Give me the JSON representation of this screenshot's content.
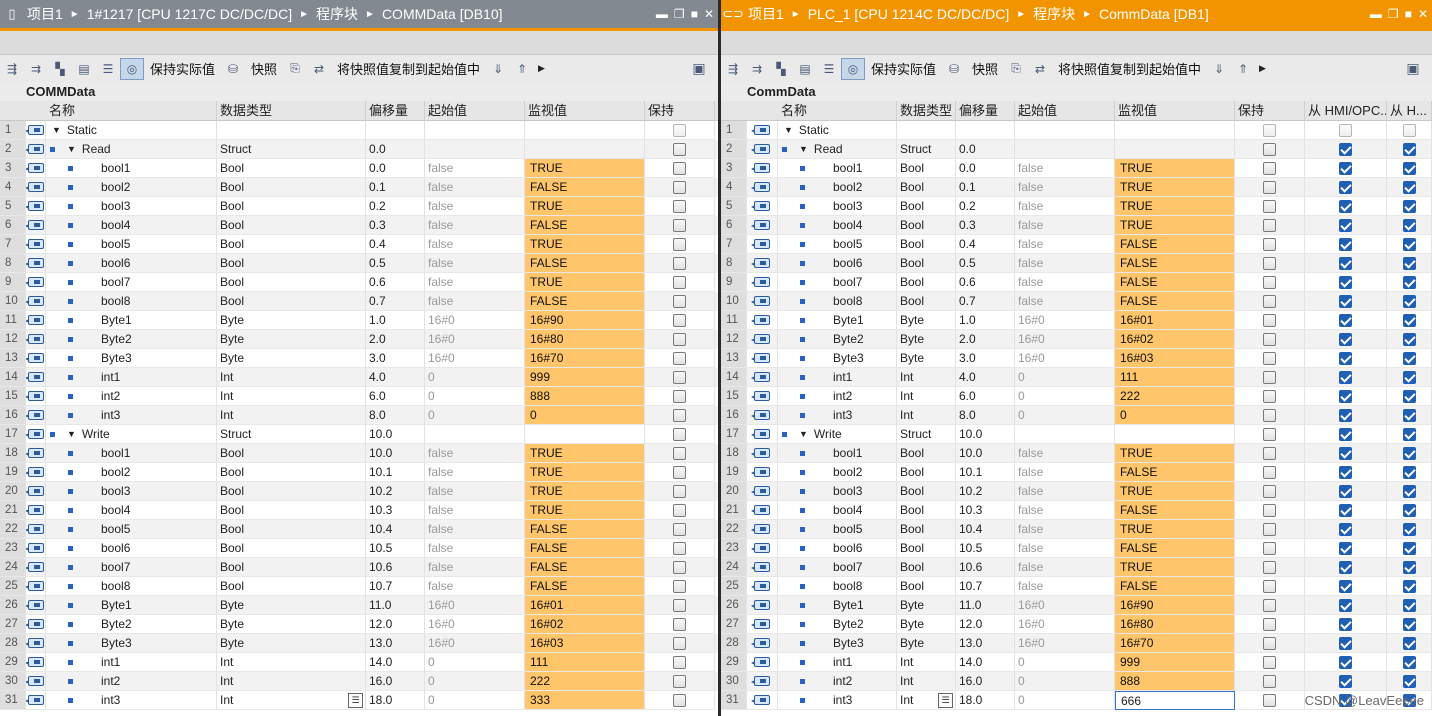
{
  "left": {
    "title": {
      "project": "项目1",
      "device": "1#1217 [CPU 1217C DC/DC/DC]",
      "blocks": "程序块",
      "db": "COMMData [DB10]"
    },
    "toolbar": {
      "keep_actual": "保持实际值",
      "snapshot": "快照",
      "copy_snapshot": "将快照值复制到起始值中"
    },
    "db_name": "COMMData",
    "columns": [
      "名称",
      "数据类型",
      "偏移量",
      "起始值",
      "监视值",
      "保持"
    ],
    "rows": [
      {
        "n": "1",
        "name": "Static",
        "type": "",
        "offset": "",
        "start": "",
        "monitor": "",
        "level": 0,
        "group": "static"
      },
      {
        "n": "2",
        "name": "Read",
        "type": "Struct",
        "offset": "0.0",
        "start": "",
        "monitor": "",
        "level": 1,
        "group": "struct"
      },
      {
        "n": "3",
        "name": "bool1",
        "type": "Bool",
        "offset": "0.0",
        "start": "false",
        "monitor": "TRUE",
        "level": 2
      },
      {
        "n": "4",
        "name": "bool2",
        "type": "Bool",
        "offset": "0.1",
        "start": "false",
        "monitor": "FALSE",
        "level": 2
      },
      {
        "n": "5",
        "name": "bool3",
        "type": "Bool",
        "offset": "0.2",
        "start": "false",
        "monitor": "TRUE",
        "level": 2
      },
      {
        "n": "6",
        "name": "bool4",
        "type": "Bool",
        "offset": "0.3",
        "start": "false",
        "monitor": "FALSE",
        "level": 2
      },
      {
        "n": "7",
        "name": "bool5",
        "type": "Bool",
        "offset": "0.4",
        "start": "false",
        "monitor": "TRUE",
        "level": 2
      },
      {
        "n": "8",
        "name": "bool6",
        "type": "Bool",
        "offset": "0.5",
        "start": "false",
        "monitor": "FALSE",
        "level": 2
      },
      {
        "n": "9",
        "name": "bool7",
        "type": "Bool",
        "offset": "0.6",
        "start": "false",
        "monitor": "TRUE",
        "level": 2
      },
      {
        "n": "10",
        "name": "bool8",
        "type": "Bool",
        "offset": "0.7",
        "start": "false",
        "monitor": "FALSE",
        "level": 2
      },
      {
        "n": "11",
        "name": "Byte1",
        "type": "Byte",
        "offset": "1.0",
        "start": "16#0",
        "monitor": "16#90",
        "level": 2
      },
      {
        "n": "12",
        "name": "Byte2",
        "type": "Byte",
        "offset": "2.0",
        "start": "16#0",
        "monitor": "16#80",
        "level": 2
      },
      {
        "n": "13",
        "name": "Byte3",
        "type": "Byte",
        "offset": "3.0",
        "start": "16#0",
        "monitor": "16#70",
        "level": 2
      },
      {
        "n": "14",
        "name": "int1",
        "type": "Int",
        "offset": "4.0",
        "start": "0",
        "monitor": "999",
        "level": 2
      },
      {
        "n": "15",
        "name": "int2",
        "type": "Int",
        "offset": "6.0",
        "start": "0",
        "monitor": "888",
        "level": 2
      },
      {
        "n": "16",
        "name": "int3",
        "type": "Int",
        "offset": "8.0",
        "start": "0",
        "monitor": "0",
        "level": 2
      },
      {
        "n": "17",
        "name": "Write",
        "type": "Struct",
        "offset": "10.0",
        "start": "",
        "monitor": "",
        "level": 1,
        "group": "struct"
      },
      {
        "n": "18",
        "name": "bool1",
        "type": "Bool",
        "offset": "10.0",
        "start": "false",
        "monitor": "TRUE",
        "level": 2
      },
      {
        "n": "19",
        "name": "bool2",
        "type": "Bool",
        "offset": "10.1",
        "start": "false",
        "monitor": "TRUE",
        "level": 2
      },
      {
        "n": "20",
        "name": "bool3",
        "type": "Bool",
        "offset": "10.2",
        "start": "false",
        "monitor": "TRUE",
        "level": 2
      },
      {
        "n": "21",
        "name": "bool4",
        "type": "Bool",
        "offset": "10.3",
        "start": "false",
        "monitor": "TRUE",
        "level": 2
      },
      {
        "n": "22",
        "name": "bool5",
        "type": "Bool",
        "offset": "10.4",
        "start": "false",
        "monitor": "FALSE",
        "level": 2
      },
      {
        "n": "23",
        "name": "bool6",
        "type": "Bool",
        "offset": "10.5",
        "start": "false",
        "monitor": "FALSE",
        "level": 2
      },
      {
        "n": "24",
        "name": "bool7",
        "type": "Bool",
        "offset": "10.6",
        "start": "false",
        "monitor": "FALSE",
        "level": 2
      },
      {
        "n": "25",
        "name": "bool8",
        "type": "Bool",
        "offset": "10.7",
        "start": "false",
        "monitor": "FALSE",
        "level": 2
      },
      {
        "n": "26",
        "name": "Byte1",
        "type": "Byte",
        "offset": "11.0",
        "start": "16#0",
        "monitor": "16#01",
        "level": 2
      },
      {
        "n": "27",
        "name": "Byte2",
        "type": "Byte",
        "offset": "12.0",
        "start": "16#0",
        "monitor": "16#02",
        "level": 2
      },
      {
        "n": "28",
        "name": "Byte3",
        "type": "Byte",
        "offset": "13.0",
        "start": "16#0",
        "monitor": "16#03",
        "level": 2
      },
      {
        "n": "29",
        "name": "int1",
        "type": "Int",
        "offset": "14.0",
        "start": "0",
        "monitor": "111",
        "level": 2
      },
      {
        "n": "30",
        "name": "int2",
        "type": "Int",
        "offset": "16.0",
        "start": "0",
        "monitor": "222",
        "level": 2
      },
      {
        "n": "31",
        "name": "int3",
        "type": "Int",
        "offset": "18.0",
        "start": "0",
        "monitor": "333",
        "level": 2
      }
    ]
  },
  "right": {
    "title": {
      "project": "项目1",
      "device": "PLC_1 [CPU 1214C DC/DC/DC]",
      "blocks": "程序块",
      "db": "CommData [DB1]"
    },
    "toolbar": {
      "keep_actual": "保持实际值",
      "snapshot": "快照",
      "copy_snapshot": "将快照值复制到起始值中"
    },
    "db_name": "CommData",
    "columns": [
      "名称",
      "数据类型",
      "偏移量",
      "起始值",
      "监视值",
      "保持",
      "从 HMI/OPC...",
      "从 H..."
    ],
    "rows": [
      {
        "n": "1",
        "name": "Static",
        "type": "",
        "offset": "",
        "start": "",
        "monitor": "",
        "level": 0,
        "group": "static"
      },
      {
        "n": "2",
        "name": "Read",
        "type": "Struct",
        "offset": "0.0",
        "start": "",
        "monitor": "",
        "level": 1,
        "group": "struct"
      },
      {
        "n": "3",
        "name": "bool1",
        "type": "Bool",
        "offset": "0.0",
        "start": "false",
        "monitor": "TRUE",
        "level": 2
      },
      {
        "n": "4",
        "name": "bool2",
        "type": "Bool",
        "offset": "0.1",
        "start": "false",
        "monitor": "TRUE",
        "level": 2
      },
      {
        "n": "5",
        "name": "bool3",
        "type": "Bool",
        "offset": "0.2",
        "start": "false",
        "monitor": "TRUE",
        "level": 2
      },
      {
        "n": "6",
        "name": "bool4",
        "type": "Bool",
        "offset": "0.3",
        "start": "false",
        "monitor": "TRUE",
        "level": 2
      },
      {
        "n": "7",
        "name": "bool5",
        "type": "Bool",
        "offset": "0.4",
        "start": "false",
        "monitor": "FALSE",
        "level": 2
      },
      {
        "n": "8",
        "name": "bool6",
        "type": "Bool",
        "offset": "0.5",
        "start": "false",
        "monitor": "FALSE",
        "level": 2
      },
      {
        "n": "9",
        "name": "bool7",
        "type": "Bool",
        "offset": "0.6",
        "start": "false",
        "monitor": "FALSE",
        "level": 2
      },
      {
        "n": "10",
        "name": "bool8",
        "type": "Bool",
        "offset": "0.7",
        "start": "false",
        "monitor": "FALSE",
        "level": 2
      },
      {
        "n": "11",
        "name": "Byte1",
        "type": "Byte",
        "offset": "1.0",
        "start": "16#0",
        "monitor": "16#01",
        "level": 2
      },
      {
        "n": "12",
        "name": "Byte2",
        "type": "Byte",
        "offset": "2.0",
        "start": "16#0",
        "monitor": "16#02",
        "level": 2
      },
      {
        "n": "13",
        "name": "Byte3",
        "type": "Byte",
        "offset": "3.0",
        "start": "16#0",
        "monitor": "16#03",
        "level": 2
      },
      {
        "n": "14",
        "name": "int1",
        "type": "Int",
        "offset": "4.0",
        "start": "0",
        "monitor": "111",
        "level": 2
      },
      {
        "n": "15",
        "name": "int2",
        "type": "Int",
        "offset": "6.0",
        "start": "0",
        "monitor": "222",
        "level": 2
      },
      {
        "n": "16",
        "name": "int3",
        "type": "Int",
        "offset": "8.0",
        "start": "0",
        "monitor": "0",
        "level": 2
      },
      {
        "n": "17",
        "name": "Write",
        "type": "Struct",
        "offset": "10.0",
        "start": "",
        "monitor": "",
        "level": 1,
        "group": "struct"
      },
      {
        "n": "18",
        "name": "bool1",
        "type": "Bool",
        "offset": "10.0",
        "start": "false",
        "monitor": "TRUE",
        "level": 2
      },
      {
        "n": "19",
        "name": "bool2",
        "type": "Bool",
        "offset": "10.1",
        "start": "false",
        "monitor": "FALSE",
        "level": 2
      },
      {
        "n": "20",
        "name": "bool3",
        "type": "Bool",
        "offset": "10.2",
        "start": "false",
        "monitor": "TRUE",
        "level": 2
      },
      {
        "n": "21",
        "name": "bool4",
        "type": "Bool",
        "offset": "10.3",
        "start": "false",
        "monitor": "FALSE",
        "level": 2
      },
      {
        "n": "22",
        "name": "bool5",
        "type": "Bool",
        "offset": "10.4",
        "start": "false",
        "monitor": "TRUE",
        "level": 2
      },
      {
        "n": "23",
        "name": "bool6",
        "type": "Bool",
        "offset": "10.5",
        "start": "false",
        "monitor": "FALSE",
        "level": 2
      },
      {
        "n": "24",
        "name": "bool7",
        "type": "Bool",
        "offset": "10.6",
        "start": "false",
        "monitor": "TRUE",
        "level": 2
      },
      {
        "n": "25",
        "name": "bool8",
        "type": "Bool",
        "offset": "10.7",
        "start": "false",
        "monitor": "FALSE",
        "level": 2
      },
      {
        "n": "26",
        "name": "Byte1",
        "type": "Byte",
        "offset": "11.0",
        "start": "16#0",
        "monitor": "16#90",
        "level": 2
      },
      {
        "n": "27",
        "name": "Byte2",
        "type": "Byte",
        "offset": "12.0",
        "start": "16#0",
        "monitor": "16#80",
        "level": 2
      },
      {
        "n": "28",
        "name": "Byte3",
        "type": "Byte",
        "offset": "13.0",
        "start": "16#0",
        "monitor": "16#70",
        "level": 2
      },
      {
        "n": "29",
        "name": "int1",
        "type": "Int",
        "offset": "14.0",
        "start": "0",
        "monitor": "999",
        "level": 2
      },
      {
        "n": "30",
        "name": "int2",
        "type": "Int",
        "offset": "16.0",
        "start": "0",
        "monitor": "888",
        "level": 2
      },
      {
        "n": "31",
        "name": "int3",
        "type": "Int",
        "offset": "18.0",
        "start": "0",
        "monitor": "666",
        "level": 2
      }
    ]
  },
  "watermark": "CSDN @LeavEeeee",
  "colors": {
    "monitor_bg": "#fec56b",
    "active_title": "#f29400",
    "inactive_title": "#828990",
    "checkbox_on": "#1f5fb4"
  }
}
